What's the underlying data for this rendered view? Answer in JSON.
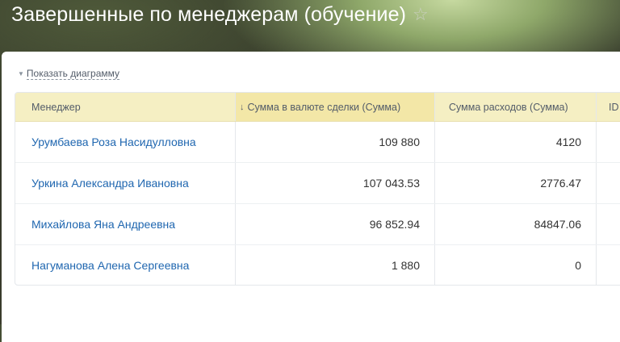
{
  "page": {
    "title": "Завершенные по менеджерам (обучение)",
    "star_icon": "☆"
  },
  "toolbar": {
    "show_chart": "Показать диаграмму",
    "show_chart_icon": "chevron-down-icon"
  },
  "table": {
    "columns": [
      {
        "label": "Менеджер"
      },
      {
        "label": "Сумма в валюте сделки (Сумма)",
        "sort_icon": "↓"
      },
      {
        "label": "Сумма расходов (Сумма)"
      },
      {
        "label": "ID"
      }
    ],
    "rows": [
      {
        "manager": "Урумбаева Роза Насидулловна",
        "deal_sum": "109 880",
        "expenses": "4120"
      },
      {
        "manager": "Уркина Александра Ивановна",
        "deal_sum": "107 043.53",
        "expenses": "2776.47"
      },
      {
        "manager": "Михайлова Яна Андреевна",
        "deal_sum": "96 852.94",
        "expenses": "84847.06"
      },
      {
        "manager": "Нагуманова Алена Сергеевна",
        "deal_sum": "1 880",
        "expenses": "0"
      }
    ]
  },
  "colors": {
    "header_bg": "#f5efc3",
    "sorted_header_bg": "#f3e7a7",
    "link": "#2067b0"
  }
}
